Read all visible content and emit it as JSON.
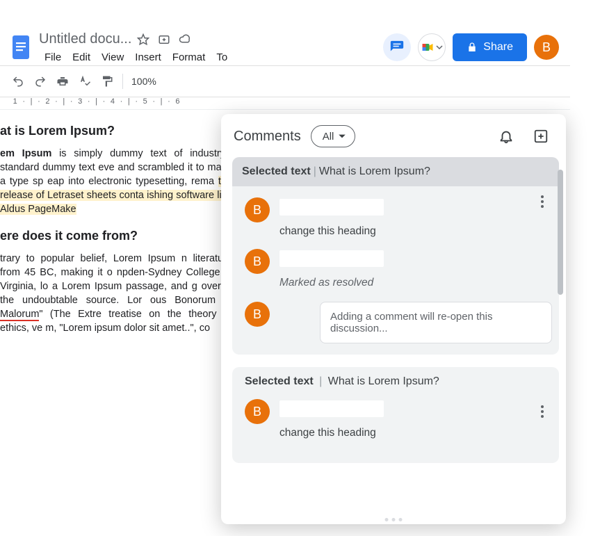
{
  "header": {
    "doc_title": "Untitled docu...",
    "menu": [
      "File",
      "Edit",
      "View",
      "Insert",
      "Format",
      "To"
    ],
    "share_label": "Share",
    "avatar_initial": "B"
  },
  "toolbar": {
    "zoom": "100%"
  },
  "ruler_text": "   1  ·  |  ·  2  ·  |  ·  3  ·  |  ·  4  ·  |  ·  5  ·  |  ·  6  ",
  "document": {
    "h1": "at is Lorem Ipsum?",
    "p1_bold": "em Ipsum",
    "p1_a": " is simply dummy text of industry's standard dummy text eve  and scrambled it to make a type sp eap into electronic typesetting, rema ",
    "p1_hl": "the release of Letraset sheets conta ishing software like Aldus PageMake",
    "h2": "ere does it come from?",
    "p2_a": "trary to popular belief, Lorem Ipsum n literature from 45 BC, making it o npden-Sydney College in Virginia, lo  a Lorem Ipsum passage, and g overed the undoubtable source. Lor ous Bonorum et ",
    "p2_mal": "Malorum",
    "p2_b": "\" (The Extre  treatise on the theory of ethics, ve m, \"Lorem ipsum dolor sit amet..\", co"
  },
  "panel": {
    "title": "Comments",
    "filter_label": "All",
    "threads": [
      {
        "selected_label": "Selected text",
        "selected_text": "What is Lorem Ipsum?",
        "items": [
          {
            "initial": "B",
            "text": "change this heading",
            "muted": false
          },
          {
            "initial": "B",
            "text": "Marked as resolved",
            "muted": true
          }
        ],
        "reply_initial": "B",
        "reply_placeholder": "Adding a comment will re-open this discussion..."
      },
      {
        "selected_label": "Selected text",
        "selected_text": "What is Lorem Ipsum?",
        "items": [
          {
            "initial": "B",
            "text": "change this heading",
            "muted": false
          }
        ]
      }
    ]
  }
}
